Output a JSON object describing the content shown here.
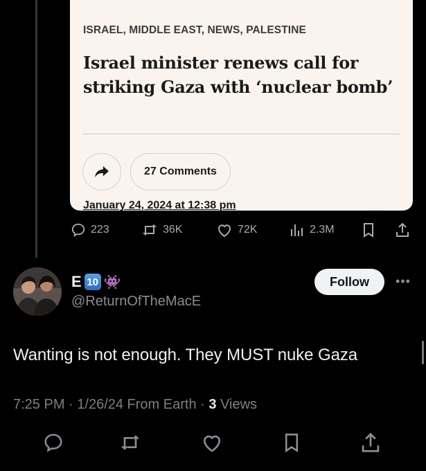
{
  "article": {
    "categories": "ISRAEL, MIDDLE EAST, NEWS, PALESTINE",
    "title": "Israel minister renews call for striking Gaza with ‘nuclear bomb’",
    "comments_label": "27 Comments",
    "date": "January 24, 2024 at 12:38 pm"
  },
  "quoted_actions": {
    "replies": "223",
    "reposts": "36K",
    "likes": "72K",
    "views": "2.3M"
  },
  "tweet": {
    "display_name_letter": "E",
    "keycap": "10",
    "emoji": "👾",
    "handle": "@ReturnOfTheMacE",
    "follow_label": "Follow",
    "more_label": "•••",
    "text": "Wanting is not enough. They MUST nuke Gaza",
    "time": "7:25 PM",
    "sep1": " · ",
    "date": "1/26/24",
    "source": " From Earth",
    "sep2": " · ",
    "views_count": "3",
    "views_label": " Views"
  },
  "colors": {
    "background": "#000000",
    "card": "#fbf3ee",
    "muted": "#7b7f84",
    "follow_bg": "#eff3f4"
  }
}
